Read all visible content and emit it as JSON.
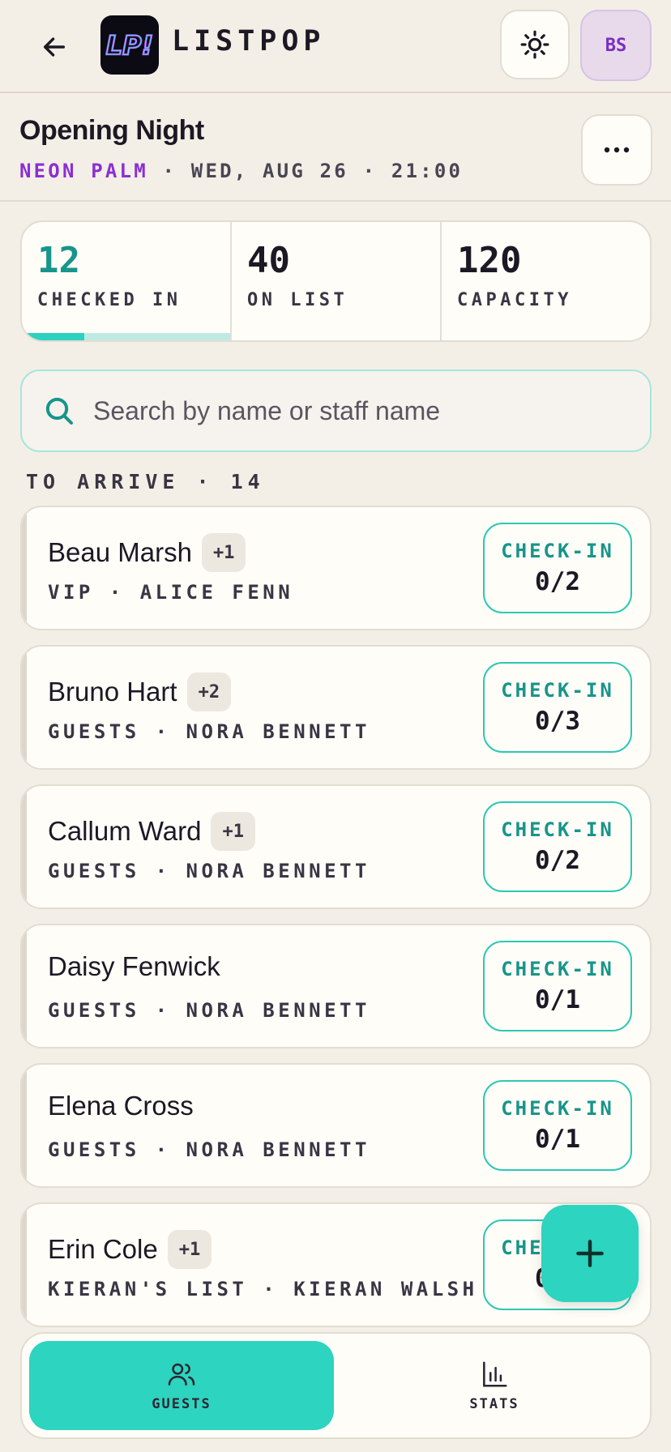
{
  "app": {
    "brand": "LISTPOP",
    "logo_text": "LP!",
    "user_initials": "BS"
  },
  "icons": {
    "back": "arrow-left-icon",
    "theme": "sun-icon",
    "more": "more-horizontal-icon",
    "search": "search-icon",
    "add": "plus-icon",
    "guests_nav": "users-icon",
    "stats_nav": "bar-chart-icon"
  },
  "colors": {
    "accent": "#2dd4bf",
    "accent_dark": "#17958a",
    "venue": "#8a2fd4",
    "background": "#f4efe6"
  },
  "event": {
    "title": "Opening Night",
    "venue": "NEON PALM",
    "meta": " · WED, AUG 26 · 21:00"
  },
  "stats": {
    "checked_in": {
      "value": "12",
      "label": "CHECKED IN"
    },
    "on_list": {
      "value": "40",
      "label": "ON LIST"
    },
    "capacity": {
      "value": "120",
      "label": "CAPACITY"
    },
    "progress_fraction": 0.3
  },
  "search": {
    "placeholder": "Search by name or staff name"
  },
  "section": {
    "title": "TO ARRIVE · 14"
  },
  "guests": [
    {
      "name": "Beau Marsh",
      "plus": "+1",
      "sub": "VIP · ALICE FENN",
      "checkin_label": "CHECK-IN",
      "count": "0/2"
    },
    {
      "name": "Bruno Hart",
      "plus": "+2",
      "sub": "GUESTS · NORA BENNETT",
      "checkin_label": "CHECK-IN",
      "count": "0/3"
    },
    {
      "name": "Callum Ward",
      "plus": "+1",
      "sub": "GUESTS · NORA BENNETT",
      "checkin_label": "CHECK-IN",
      "count": "0/2"
    },
    {
      "name": "Daisy Fenwick",
      "plus": "",
      "sub": "GUESTS · NORA BENNETT",
      "checkin_label": "CHECK-IN",
      "count": "0/1"
    },
    {
      "name": "Elena Cross",
      "plus": "",
      "sub": "GUESTS · NORA BENNETT",
      "checkin_label": "CHECK-IN",
      "count": "0/1"
    },
    {
      "name": "Erin Cole",
      "plus": "+1",
      "sub": "KIERAN'S LIST · KIERAN WALSH",
      "checkin_label": "CHECK-IN",
      "count": "0/2"
    }
  ],
  "nav": {
    "guests_label": "GUESTS",
    "stats_label": "STATS"
  }
}
